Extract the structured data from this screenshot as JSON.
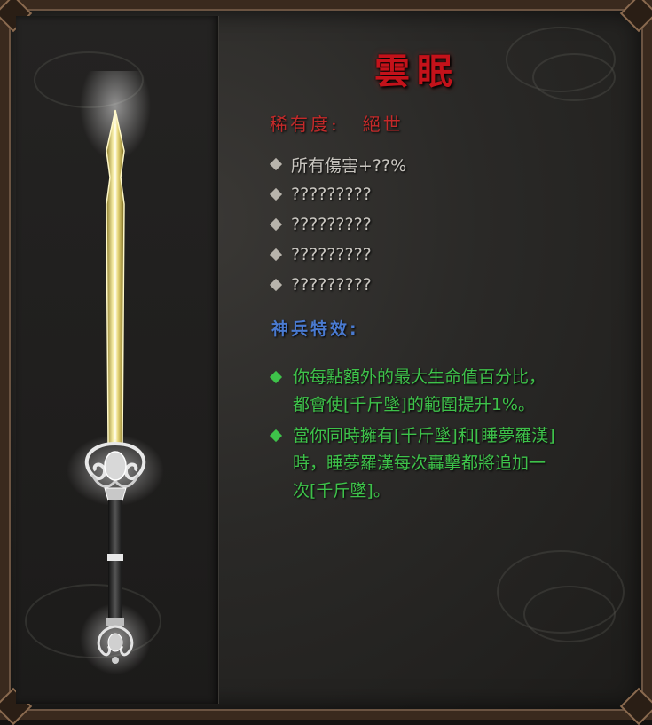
{
  "item": {
    "name": "雲眠",
    "rarity_label": "稀有度:",
    "rarity_value": "絕世"
  },
  "stats": [
    "所有傷害+??%",
    "?????????",
    "?????????",
    "?????????",
    "?????????"
  ],
  "special": {
    "heading": "神兵特效:",
    "effects": [
      "你每點額外的最大生命值百分比，\n都會使[千斤墜]的範圍提升1%。",
      "當你同時擁有[千斤墜]和[睡夢羅漢]\n時，睡夢羅漢每次轟擊都將追加一\n次[千斤墜]。"
    ]
  },
  "colors": {
    "title": "#c4121a",
    "rarity": "#c42a2a",
    "stat_text": "#c9c6c0",
    "special_heading": "#4a7ad0",
    "effect_text": "#3ec24a"
  },
  "icons": {
    "weapon": "sword-icon",
    "stat_bullet": "diamond-icon",
    "effect_bullet": "green-diamond-icon"
  }
}
